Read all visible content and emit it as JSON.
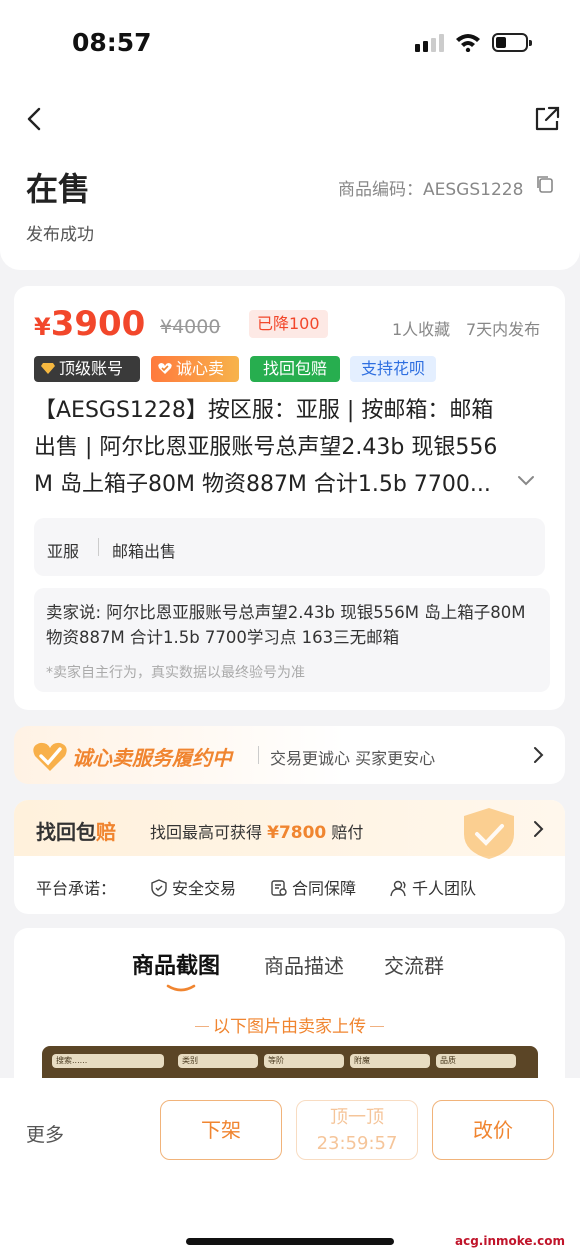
{
  "status_bar": {
    "time": "08:57",
    "battery_level": 0.35
  },
  "header": {
    "title": "在售",
    "subtitle": "发布成功",
    "code_label": "商品编码：AESGS1228"
  },
  "listing": {
    "price_symbol": "¥",
    "price": "3900",
    "original_price": "¥4000",
    "drop_badge": "已降100",
    "favorites": "1人收藏",
    "published": "7天内发布",
    "tags": [
      "顶级账号",
      "诚心卖",
      "找回包赔",
      "支持花呗"
    ],
    "title_lines": [
      "【AESGS1228】按区服：亚服 | 按邮箱：邮箱",
      "出售 | 阿尔比恩亚服账号总声望2.43b 现银556",
      "M 岛上箱子80M 物资887M 合计1.5b 7700..."
    ],
    "attr_server": "亚服",
    "attr_mail": "邮箱出售",
    "seller_says": "卖家说: 阿尔比恩亚服账号总声望2.43b 现银556M 岛上箱子80M 物资887M 合计1.5b 7700学习点 163三无邮箱",
    "seller_note": "*卖家自主行为，真实数据以最终验号为准"
  },
  "honest_service": {
    "title": "诚心卖服务履约中",
    "subtitle": "交易更诚心 买家更安心"
  },
  "recover": {
    "logo_main": "找回包",
    "logo_accent": "赔",
    "desc_prefix": "找回最高可获得",
    "amount": "¥7800",
    "desc_suffix": "赔付"
  },
  "promise": {
    "label": "平台承诺：",
    "items": [
      "安全交易",
      "合同保障",
      "千人团队"
    ]
  },
  "tabs": [
    "商品截图",
    "商品描述",
    "交流群"
  ],
  "upload_note": "以下图片由卖家上传",
  "screenshot_fields": [
    "搜索......",
    "类别",
    "等阶",
    "附魔",
    "品质"
  ],
  "bottom": {
    "more": "更多",
    "delist": "下架",
    "bump": "顶一顶",
    "bump_timer": "23:59:57",
    "change_price": "改价"
  },
  "watermark": "acg.inmoke.com",
  "colors": {
    "accent": "#f08530",
    "price": "#f2472b",
    "green": "#27ae4f",
    "blue": "#2f6fe0"
  }
}
